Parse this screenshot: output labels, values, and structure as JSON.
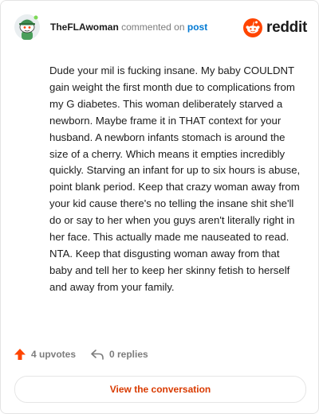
{
  "comment": {
    "username": "TheFLAwoman",
    "action_text": "commented on",
    "post_link_text": "post",
    "body": "Dude your mil is fucking insane. My baby COULDNT gain weight the first month due to complications from my G diabetes. This woman deliberately starved a newborn. Maybe frame it in THAT context for your husband. A newborn infants stomach is around the size of a cherry. Which means it empties incredibly quickly. Starving an infant for up to six hours is abuse, point blank period. Keep that crazy woman away from your kid cause there's no telling the insane shit she'll do or say to her when you guys aren't literally right in her face. This actually made me nauseated to read. NTA. Keep that disgusting woman away from that baby and tell her to keep her skinny fetish to herself and away from your family."
  },
  "brand": {
    "wordmark": "reddit",
    "icon": "reddit-snoo-icon",
    "color": "#ff4500"
  },
  "footer": {
    "upvotes_label": "4 upvotes",
    "upvote_icon": "upvote-arrow-icon",
    "replies_label": "0 replies",
    "reply_icon": "reply-arrow-icon"
  },
  "cta": {
    "label": "View the conversation"
  },
  "colors": {
    "accent": "#d93a00",
    "link": "#0079d3",
    "upvote": "#ff4500"
  }
}
